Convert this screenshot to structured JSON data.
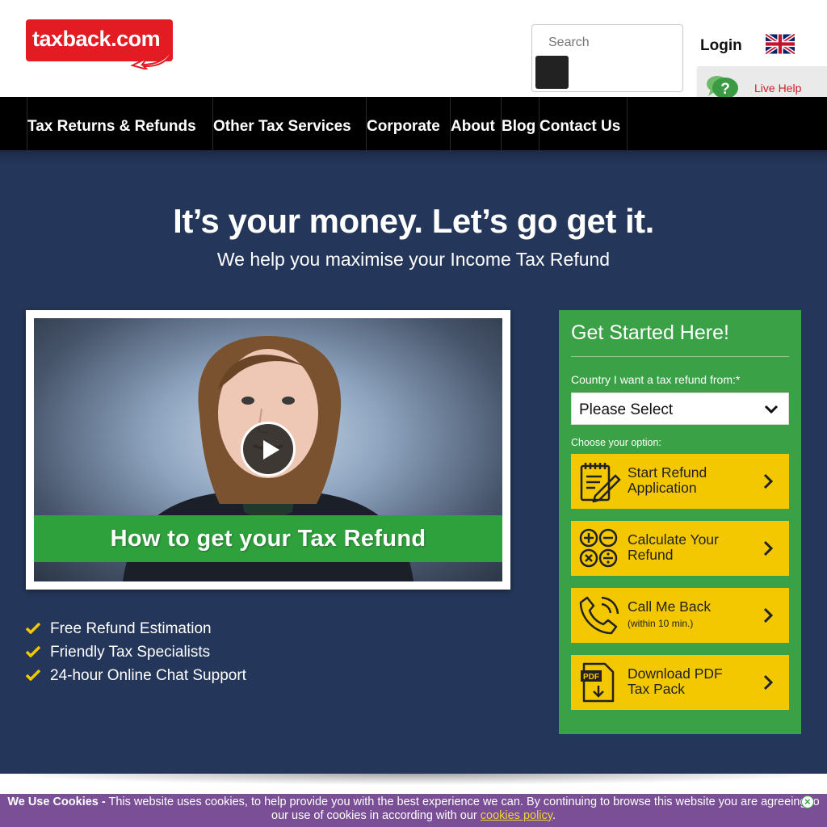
{
  "header": {
    "logo_text": "taxback.com",
    "search_placeholder": "Search",
    "login_label": "Login",
    "live_help_label": "Live Help"
  },
  "nav": {
    "items": [
      {
        "label": "Tax Returns & Refunds"
      },
      {
        "label": "Other Tax Services"
      },
      {
        "label": "Corporate"
      },
      {
        "label": "About"
      },
      {
        "label": "Blog"
      },
      {
        "label": "Contact Us"
      }
    ]
  },
  "hero": {
    "title": "It’s your money. Let’s go get it.",
    "subtitle": "We help you maximise your Income Tax Refund",
    "video_banner": "How to get your Tax Refund",
    "features": [
      "Free Refund Estimation",
      "Friendly Tax Specialists",
      "24-hour Online Chat Support"
    ]
  },
  "panel": {
    "title": "Get Started Here!",
    "country_label": "Country I want a tax refund from:*",
    "select_value": "Please Select",
    "choose_label": "Choose your option:",
    "options": [
      {
        "line1": "Start Refund",
        "line2": "Application",
        "icon": "clipboard-pencil-icon"
      },
      {
        "line1": "Calculate Your",
        "line2": "Refund",
        "icon": "calculator-icon"
      },
      {
        "line1": "Call Me Back",
        "line2": "(within 10 min.)",
        "icon": "phone-icon"
      },
      {
        "line1": "Download PDF",
        "line2": "Tax Pack",
        "icon": "pdf-download-icon"
      }
    ]
  },
  "cookie": {
    "title": "We Use Cookies -",
    "text": " This website uses cookies, to help provide you with the best experience we can. By continuing to browse this website you are agreeing to our use of cookies in according with our ",
    "link": "cookies policy",
    "end": "."
  },
  "colors": {
    "brand_red": "#e31b23",
    "nav_bg": "#000000",
    "hero_bg": "#243659",
    "panel_green": "#3aa147",
    "option_yellow": "#f4c800",
    "cookie_purple": "#7a4f96"
  }
}
